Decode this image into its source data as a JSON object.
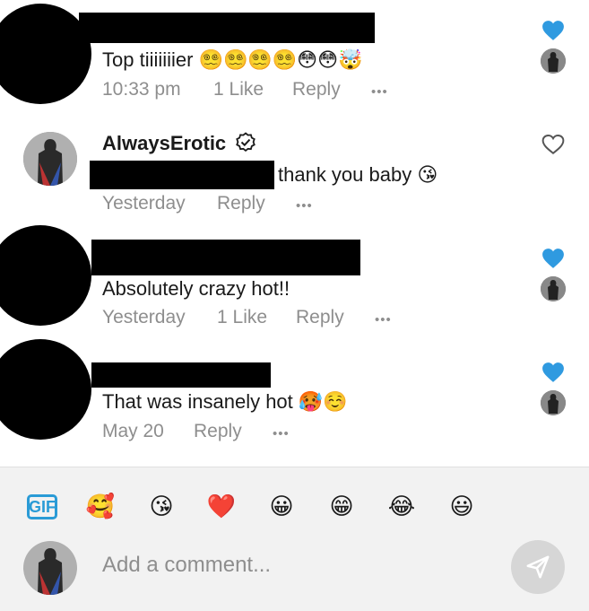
{
  "comments": [
    {
      "text": "Top tiiiiiiier",
      "emojis": "😵‍💫😵‍💫😵‍💫😵‍💫😳😳🤯",
      "time": "10:33 pm",
      "likes": "1 Like",
      "reply": "Reply",
      "more": "•••",
      "liked": true
    },
    {
      "username": "AlwaysErotic",
      "text": "thank you baby",
      "emojis": "😘",
      "time": "Yesterday",
      "reply": "Reply",
      "more": "•••",
      "liked": false
    },
    {
      "text": "Absolutely crazy hot!!",
      "time": "Yesterday",
      "likes": "1 Like",
      "reply": "Reply",
      "more": "•••",
      "liked": true
    },
    {
      "text": "That was insanely hot",
      "emojis": "🥵☺️",
      "time": "May 20",
      "reply": "Reply",
      "more": "•••",
      "liked": true
    }
  ],
  "composer": {
    "gif_label": "GIF",
    "reactions": [
      "🥰",
      "😘",
      "❤️",
      "😀",
      "😁",
      "😂",
      "😃"
    ],
    "placeholder": "Add a comment..."
  },
  "colors": {
    "like_blue": "#2f9ae0",
    "meta_gray": "#8e8e8e"
  }
}
